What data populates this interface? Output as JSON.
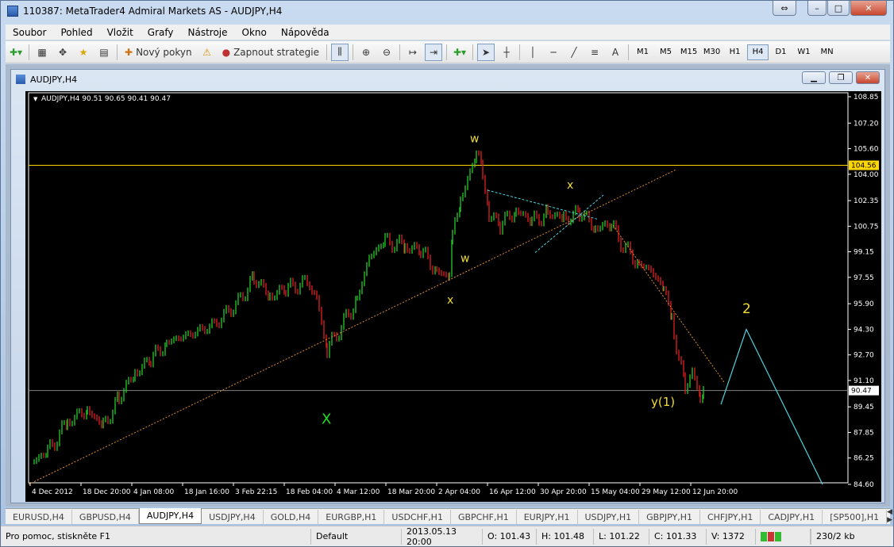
{
  "window": {
    "title": "110387: MetaTrader4 Admiral Markets AS - AUDJPY,H4"
  },
  "menu": [
    "Soubor",
    "Pohled",
    "Vložit",
    "Grafy",
    "Nástroje",
    "Okno",
    "Nápověda"
  ],
  "toolbar": {
    "new_order_label": "Nový pokyn",
    "start_strategy_label": "Zapnout strategie",
    "text_tool_label": "A",
    "timeframes": [
      "M1",
      "M5",
      "M15",
      "M30",
      "H1",
      "H4",
      "D1",
      "W1",
      "MN"
    ],
    "active_timeframe": "H4"
  },
  "chart_window": {
    "title": "AUDJPY,H4"
  },
  "chart_data": {
    "type": "line",
    "header": "AUDJPY,H4  90.51 90.65 90.41 90.47",
    "y_ticks": [
      "108.85",
      "107.20",
      "105.60",
      "104.00",
      "102.35",
      "100.75",
      "99.15",
      "97.55",
      "95.90",
      "94.30",
      "92.70",
      "91.10",
      "89.45",
      "87.85",
      "86.25",
      "84.60"
    ],
    "x_ticks": [
      "4 Dec 2012",
      "18 Dec 20:00",
      "4 Jan 08:00",
      "18 Jan 16:00",
      "3 Feb 22:15",
      "18 Feb 04:00",
      "4 Mar 12:00",
      "18 Mar 20:00",
      "2 Apr 04:00",
      "16 Apr 12:00",
      "30 Apr 20:00",
      "15 May 04:00",
      "29 May 12:00",
      "12 Jun 20:00"
    ],
    "ylim": [
      84.6,
      108.85
    ],
    "horizontal_level": {
      "label": "104.56",
      "value": 104.56,
      "color": "#ffd700"
    },
    "current_price": {
      "label": "90.47",
      "value": 90.47
    },
    "wave_labels": [
      {
        "text": "X",
        "color": "#22dd22"
      },
      {
        "text": "w",
        "color": "#f0dc30"
      },
      {
        "text": "x",
        "color": "#f0dc30"
      },
      {
        "text": "w",
        "color": "#f0dc30"
      },
      {
        "text": "x",
        "color": "#f0dc30"
      },
      {
        "text": "y(1)",
        "color": "#f0dc30"
      },
      {
        "text": "2",
        "color": "#f0dc30"
      }
    ],
    "colors": {
      "up": "#22cc22",
      "down": "#e02020",
      "trend": "#e08a30",
      "projection": "#4fd2e0",
      "grid": "#2e2e2e"
    }
  },
  "tabs": [
    "EURUSD,H4",
    "GBPUSD,H4",
    "AUDJPY,H4",
    "USDJPY,H4",
    "GOLD,H4",
    "EURGBP,H1",
    "USDCHF,H1",
    "GBPCHF,H1",
    "EURJPY,H1",
    "USDJPY,H1",
    "GBPJPY,H1",
    "CHFJPY,H1",
    "CADJPY,H1",
    "[SP500],H1"
  ],
  "active_tab": "AUDJPY,H4",
  "status": {
    "help": "Pro pomoc, stiskněte F1",
    "profile": "Default",
    "datetime": "2013.05.13 20:00",
    "open": "O: 101.43",
    "high": "H: 101.48",
    "low": "L: 101.22",
    "close": "C: 101.33",
    "volume": "V: 1372",
    "traffic": "230/2 kb"
  }
}
